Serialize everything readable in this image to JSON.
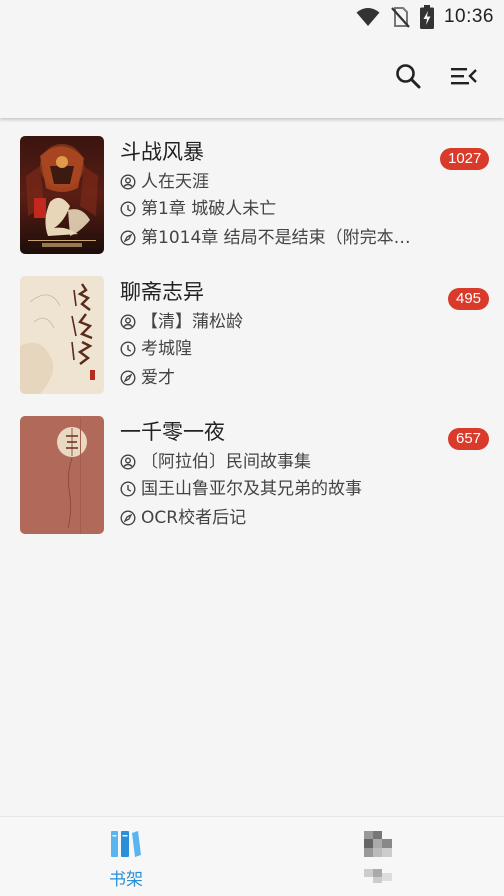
{
  "status_bar": {
    "time": "10:36",
    "icons": [
      "wifi-icon",
      "no-sim-icon",
      "battery-charging-icon"
    ]
  },
  "app_bar": {
    "actions": [
      "search-icon",
      "menu-collapse-icon"
    ]
  },
  "books": [
    {
      "title": "斗战风暴",
      "author": "人在天涯",
      "read_chapter": "第1章 城破人未亡",
      "latest_chapter": "第1014章 结局不是结束（附完本…",
      "unread_count": "1027",
      "cover_art": "dark-red-warrior-cover"
    },
    {
      "title": "聊斋志异",
      "author": "【清】蒲松龄",
      "read_chapter": "考城隍",
      "latest_chapter": "爱才",
      "unread_count": "495",
      "cover_art": "beige-calligraphy-cover"
    },
    {
      "title": "一千零一夜",
      "author": "〔阿拉伯〕民间故事集",
      "read_chapter": "国王山鲁亚尔及其兄弟的故事",
      "latest_chapter": "OCR校者后记",
      "unread_count": "657",
      "cover_art": "terracotta-circle-cover"
    }
  ],
  "bottom_nav": {
    "items": [
      {
        "label": "书架",
        "icon": "bookshelf-icon",
        "active": true
      },
      {
        "label": "",
        "icon": "discover-icon-pixelated",
        "active": false
      }
    ]
  },
  "colors": {
    "accent": "#2b8fd8",
    "badge": "#d93a2a",
    "background": "#f5f5f5"
  }
}
